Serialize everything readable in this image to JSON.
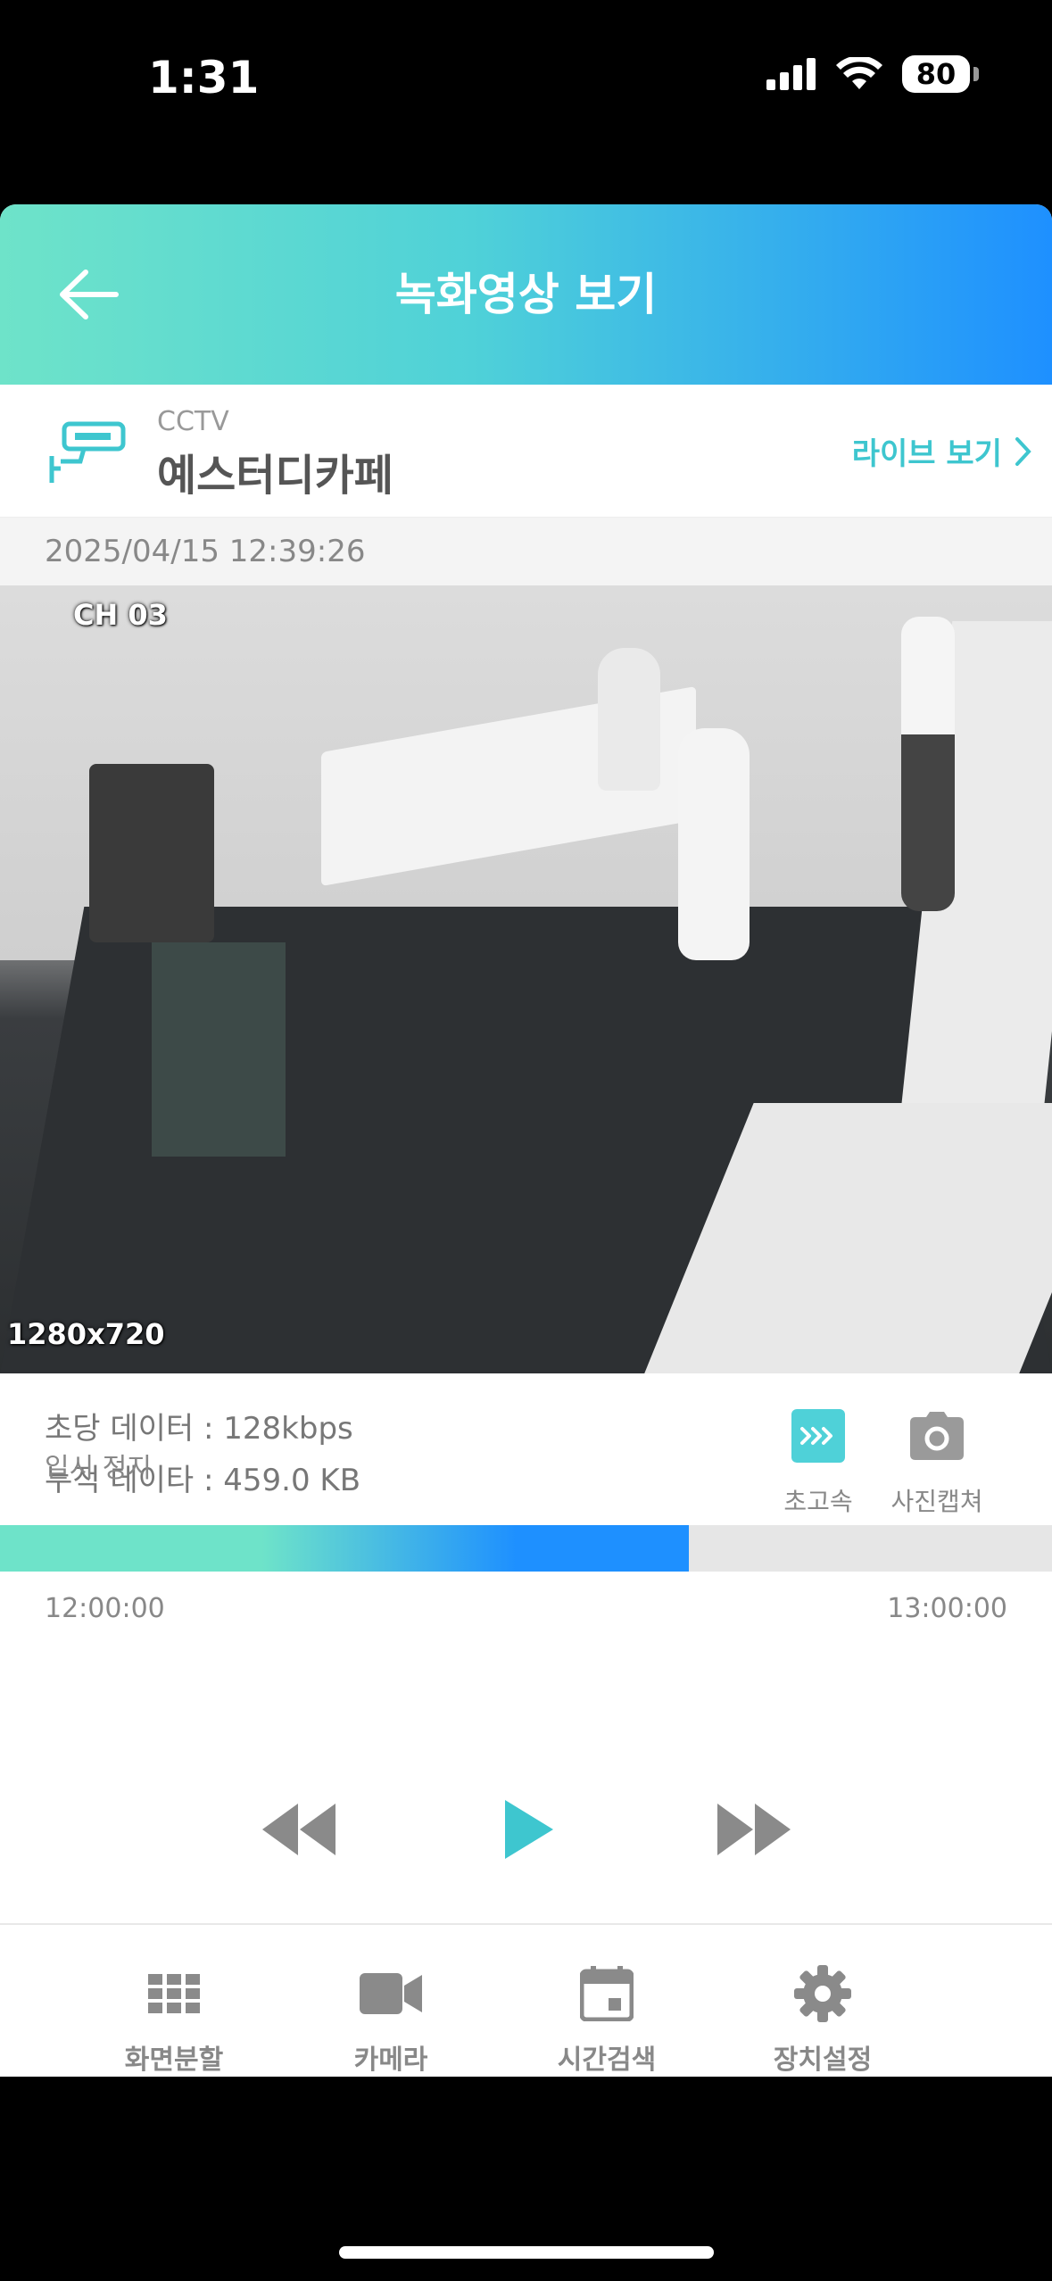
{
  "status": {
    "time": "1:31",
    "battery": "80"
  },
  "header": {
    "title": "녹화영상 보기"
  },
  "device": {
    "type": "CCTV",
    "name": "예스터디카페",
    "live_label": "라이브 보기"
  },
  "timestamp": "2025/04/15 12:39:26",
  "video": {
    "channel": "CH 03",
    "resolution": "1280x720"
  },
  "info": {
    "rate": "초당 데이터 : 128kbps",
    "total": "누적 데이타 : 459.0 KB"
  },
  "actions": {
    "turbo_label": "초고속",
    "capture_label": "사진캡쳐"
  },
  "timeline": {
    "start": "12:00:00",
    "end": "13:00:00",
    "progress_fraction": 0.655,
    "state": "일시 정지"
  },
  "tabs": [
    {
      "label": "화면분할",
      "icon": "grid-icon"
    },
    {
      "label": "카메라",
      "icon": "video-camera-icon"
    },
    {
      "label": "시간검색",
      "icon": "calendar-icon"
    },
    {
      "label": "장치설정",
      "icon": "gear-icon"
    }
  ],
  "colors": {
    "accent": "#3ec6cf",
    "gradient_start": "#6ee3c9",
    "gradient_end": "#1e90ff"
  }
}
